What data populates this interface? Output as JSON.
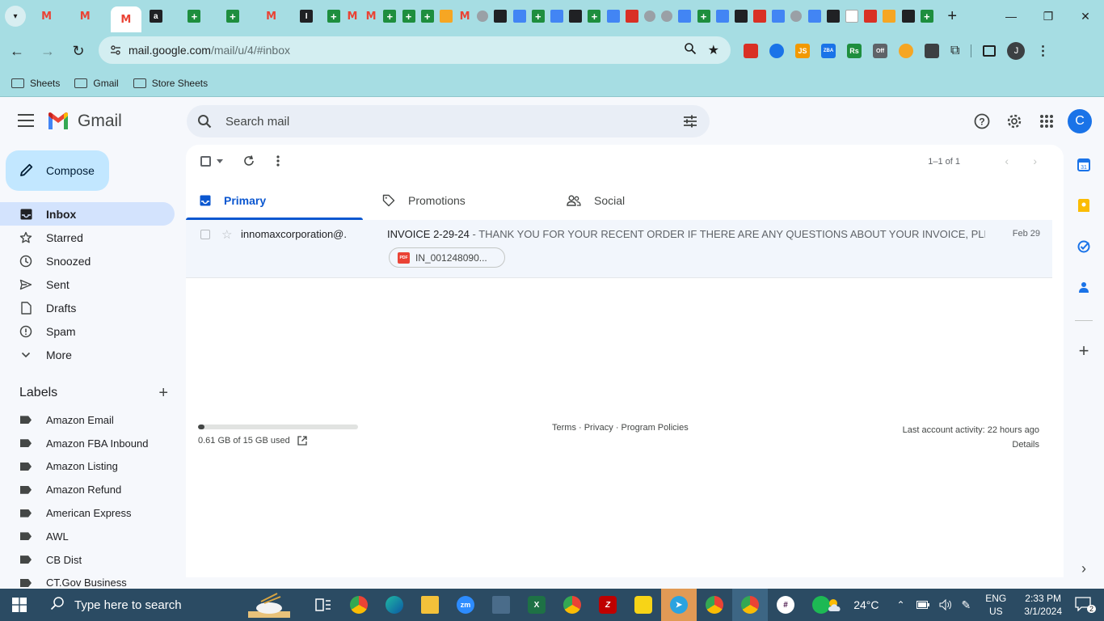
{
  "browser": {
    "url_host": "mail.google.com",
    "url_path": "/mail/u/4/#inbox",
    "profile_initial": "J",
    "bookmarks": [
      "Sheets",
      "Gmail",
      "Store Sheets"
    ],
    "extensions": [
      {
        "icon": "extension-red-icon",
        "color": "#d93025",
        "text": ""
      },
      {
        "icon": "extension-blue-icon",
        "color": "#1a73e8",
        "text": ""
      },
      {
        "icon": "extension-js-icon",
        "color": "#f29900",
        "text": "JS"
      },
      {
        "icon": "extension-zba-icon",
        "color": "#1a73e8",
        "text": "ZBA"
      },
      {
        "icon": "extension-rs-icon",
        "color": "#1e8e3e",
        "text": "Rs"
      },
      {
        "icon": "extension-off-icon",
        "color": "#5f6368",
        "text": "Off"
      },
      {
        "icon": "extension-orange-icon",
        "color": "#f6a623",
        "text": ""
      },
      {
        "icon": "extension-qr-icon",
        "color": "#3c4043",
        "text": ""
      }
    ]
  },
  "gmail": {
    "app_name": "Gmail",
    "search_placeholder": "Search mail",
    "account_initial": "C",
    "compose_label": "Compose",
    "nav": [
      {
        "label": "Inbox",
        "icon": "inbox-icon",
        "active": true
      },
      {
        "label": "Starred",
        "icon": "star-icon",
        "active": false
      },
      {
        "label": "Snoozed",
        "icon": "clock-icon",
        "active": false
      },
      {
        "label": "Sent",
        "icon": "send-icon",
        "active": false
      },
      {
        "label": "Drafts",
        "icon": "draft-icon",
        "active": false
      },
      {
        "label": "Spam",
        "icon": "spam-icon",
        "active": false
      },
      {
        "label": "More",
        "icon": "chevron-down-icon",
        "active": false
      }
    ],
    "labels_heading": "Labels",
    "labels": [
      "Amazon Email",
      "Amazon FBA Inbound",
      "Amazon Listing",
      "Amazon Refund",
      "American Express",
      "AWL",
      "CB Dist",
      "CT.Gov Business"
    ],
    "pager_text": "1–1 of 1",
    "tabs": [
      {
        "label": "Primary",
        "icon": "inbox-tab-icon",
        "active": true
      },
      {
        "label": "Promotions",
        "icon": "tag-icon",
        "active": false
      },
      {
        "label": "Social",
        "icon": "people-icon",
        "active": false
      }
    ],
    "emails": [
      {
        "sender": "innomaxcorporation@.",
        "subject": "INVOICE 2-29-24",
        "snippet": " - THANK YOU FOR YOUR RECENT ORDER IF THERE ARE ANY QUESTIONS ABOUT YOUR INVOICE, PLEASE C...",
        "date": "Feb 29",
        "attachment": "IN_001248090..."
      }
    ],
    "storage": {
      "used_text": "0.61 GB of 15 GB used",
      "fraction_used": 0.04
    },
    "footer_links": "Terms · Privacy · Program Policies",
    "last_activity": "Last account activity: 22 hours ago",
    "details_link": "Details"
  },
  "taskbar": {
    "search_placeholder": "Type here to search",
    "weather_temp": "24°C",
    "lang_line1": "ENG",
    "lang_line2": "US",
    "time": "2:33 PM",
    "date": "3/1/2024",
    "notification_count": "2"
  },
  "colors": {
    "chrome_bg": "#a6dde3",
    "compose_bg": "#c2e7ff",
    "active_nav_bg": "#d3e3fd",
    "accent_blue": "#0b57d0",
    "taskbar_bg": "#2b4b63"
  }
}
